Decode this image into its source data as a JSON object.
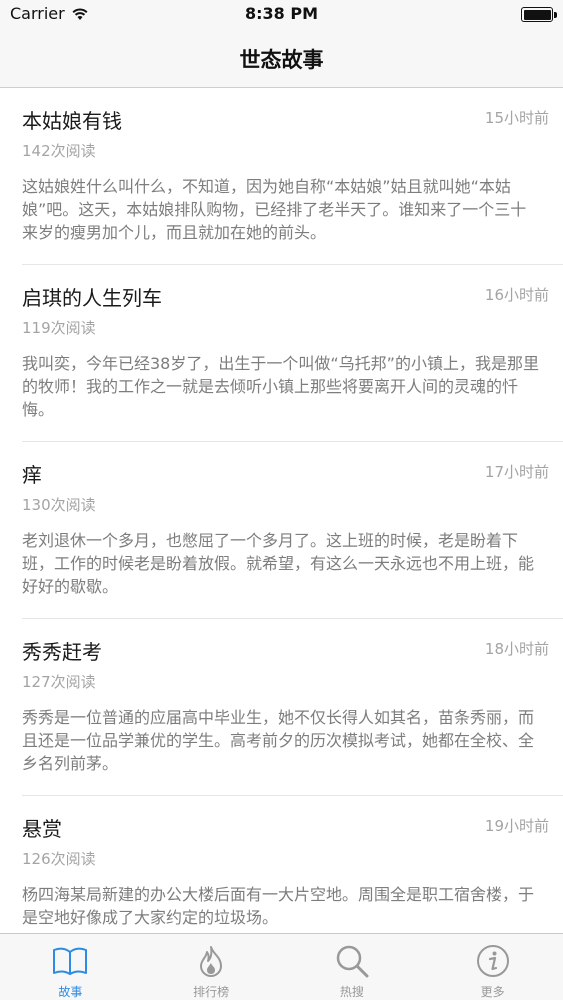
{
  "status_bar": {
    "carrier": "Carrier",
    "time": "8:38 PM"
  },
  "nav": {
    "title": "世态故事"
  },
  "stories": [
    {
      "title": "本姑娘有钱",
      "time": "15小时前",
      "reads": "142次阅读",
      "summary": "这姑娘姓什么叫什么，不知道，因为她自称“本姑娘”姑且就叫她“本姑娘”吧。这天，本姑娘排队购物，已经排了老半天了。谁知来了一个三十来岁的瘦男加个儿，而且就加在她的前头。"
    },
    {
      "title": "启琪的人生列车",
      "time": "16小时前",
      "reads": "119次阅读",
      "summary": "我叫奕，今年已经38岁了，出生于一个叫做“乌托邦”的小镇上，我是那里的牧师！我的工作之一就是去倾听小镇上那些将要离开人间的灵魂的忏悔。"
    },
    {
      "title": "痒",
      "time": "17小时前",
      "reads": "130次阅读",
      "summary": "老刘退休一个多月，也憋屈了一个多月了。这上班的时候，老是盼着下班，工作的时候老是盼着放假。就希望，有这么一天永远也不用上班，能好好的歇歇。"
    },
    {
      "title": "秀秀赶考",
      "time": "18小时前",
      "reads": "127次阅读",
      "summary": "秀秀是一位普通的应届高中毕业生，她不仅长得人如其名，苗条秀丽，而且还是一位品学兼优的学生。高考前夕的历次模拟考试，她都在全校、全乡名列前茅。"
    },
    {
      "title": "悬赏",
      "time": "19小时前",
      "reads": "126次阅读",
      "summary": "杨四海某局新建的办公大楼后面有一大片空地。周围全是职工宿舍楼，于是空地好像成了大家约定的垃圾场。"
    }
  ],
  "tabs": [
    {
      "label": "故事",
      "icon": "book-icon",
      "active": true
    },
    {
      "label": "排行榜",
      "icon": "flame-icon",
      "active": false
    },
    {
      "label": "热搜",
      "icon": "search-icon",
      "active": false
    },
    {
      "label": "更多",
      "icon": "info-icon",
      "active": false
    }
  ],
  "colors": {
    "accent": "#2c8be3",
    "inactive": "#999999",
    "secondary_text": "#a4a4a4"
  }
}
